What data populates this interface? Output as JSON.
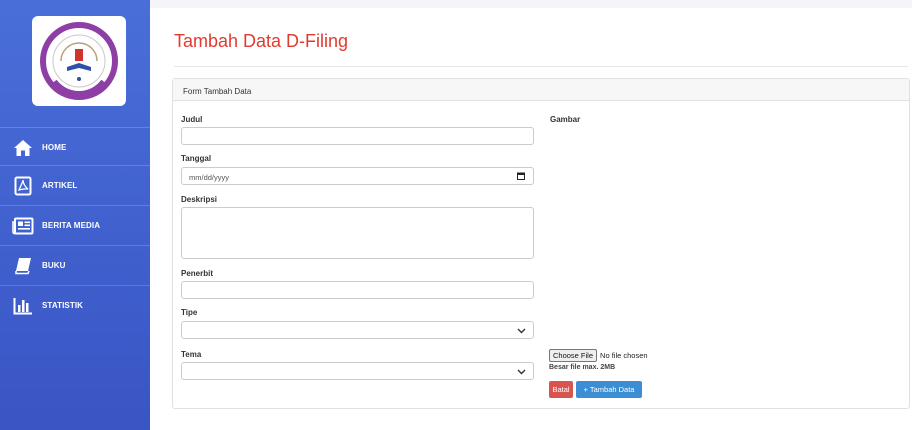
{
  "sidebar": {
    "logo_alt": "logo",
    "items": [
      {
        "label": "HOME",
        "icon": "home-icon"
      },
      {
        "label": "ARTIKEL",
        "icon": "pdf-document-icon"
      },
      {
        "label": "BERITA MEDIA",
        "icon": "newspaper-icon"
      },
      {
        "label": "BUKU",
        "icon": "book-icon"
      },
      {
        "label": "STATISTIK",
        "icon": "bar-chart-icon"
      }
    ]
  },
  "page": {
    "title": "Tambah Data D-Filing"
  },
  "form": {
    "card_title": "Form Tambah Data",
    "judul_label": "Judul",
    "judul_value": "",
    "tanggal_label": "Tanggal",
    "tanggal_placeholder": "mm/dd/yyyy",
    "deskripsi_label": "Deskripsi",
    "deskripsi_value": "",
    "penerbit_label": "Penerbit",
    "penerbit_value": "",
    "tipe_label": "Tipe",
    "tipe_selected": "",
    "tema_label": "Tema",
    "tema_selected": "",
    "gambar_label": "Gambar",
    "file_button": "Choose File",
    "file_status": "No file chosen",
    "file_note": "Besar file max. 2MB",
    "cancel_button": "Batal",
    "submit_button": "+ Tambah Data"
  },
  "colors": {
    "sidebar": "#4a6ed8",
    "title": "#e33a2f",
    "cancel": "#d9534f",
    "submit": "#3b8dd4",
    "logo_ring": "#8e3fa6"
  }
}
